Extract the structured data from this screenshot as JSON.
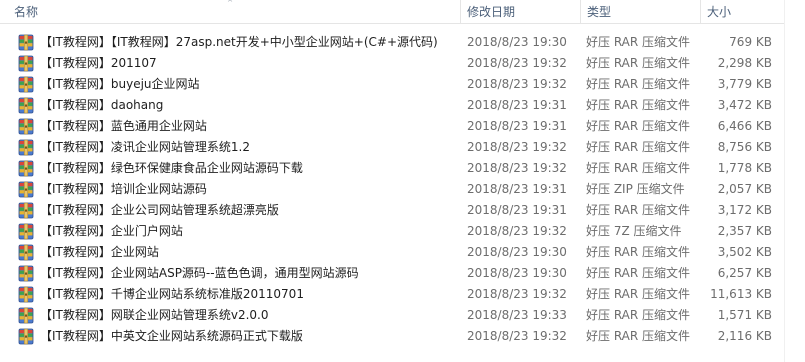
{
  "columns": {
    "name": "名称",
    "date": "修改日期",
    "type": "类型",
    "size": "大小"
  },
  "sort_indicator": "^",
  "icon": "rar-archive-icon",
  "files": [
    {
      "name": "【IT教程网】【IT教程网】27asp.net开发+中小型企业网站+(C#+源代码)",
      "date": "2018/8/23 19:30",
      "type": "好压 RAR 压缩文件",
      "size": "769 KB"
    },
    {
      "name": "【IT教程网】201107",
      "date": "2018/8/23 19:32",
      "type": "好压 RAR 压缩文件",
      "size": "2,298 KB"
    },
    {
      "name": "【IT教程网】buyeju企业网站",
      "date": "2018/8/23 19:32",
      "type": "好压 RAR 压缩文件",
      "size": "3,779 KB"
    },
    {
      "name": "【IT教程网】daohang",
      "date": "2018/8/23 19:31",
      "type": "好压 RAR 压缩文件",
      "size": "3,472 KB"
    },
    {
      "name": "【IT教程网】蓝色通用企业网站",
      "date": "2018/8/23 19:31",
      "type": "好压 RAR 压缩文件",
      "size": "6,466 KB"
    },
    {
      "name": "【IT教程网】凌讯企业网站管理系统1.2",
      "date": "2018/8/23 19:32",
      "type": "好压 RAR 压缩文件",
      "size": "8,756 KB"
    },
    {
      "name": "【IT教程网】绿色环保健康食品企业网站源码下载",
      "date": "2018/8/23 19:32",
      "type": "好压 RAR 压缩文件",
      "size": "1,778 KB"
    },
    {
      "name": "【IT教程网】培训企业网站源码",
      "date": "2018/8/23 19:31",
      "type": "好压 ZIP 压缩文件",
      "size": "2,057 KB"
    },
    {
      "name": "【IT教程网】企业公司网站管理系统超漂亮版",
      "date": "2018/8/23 19:31",
      "type": "好压 RAR 压缩文件",
      "size": "3,172 KB"
    },
    {
      "name": "【IT教程网】企业门户网站",
      "date": "2018/8/23 19:32",
      "type": "好压 7Z 压缩文件",
      "size": "2,357 KB"
    },
    {
      "name": "【IT教程网】企业网站",
      "date": "2018/8/23 19:30",
      "type": "好压 RAR 压缩文件",
      "size": "3,502 KB"
    },
    {
      "name": "【IT教程网】企业网站ASP源码--蓝色色调，通用型网站源码",
      "date": "2018/8/23 19:30",
      "type": "好压 RAR 压缩文件",
      "size": "6,257 KB"
    },
    {
      "name": "【IT教程网】千博企业网站系统标准版20110701",
      "date": "2018/8/23 19:32",
      "type": "好压 RAR 压缩文件",
      "size": "11,613 KB"
    },
    {
      "name": "【IT教程网】网联企业网站管理系统v2.0.0",
      "date": "2018/8/23 19:33",
      "type": "好压 RAR 压缩文件",
      "size": "1,571 KB"
    },
    {
      "name": "【IT教程网】中英文企业网站系统源码正式下载版",
      "date": "2018/8/23 19:32",
      "type": "好压 RAR 压缩文件",
      "size": "2,116 KB"
    }
  ]
}
